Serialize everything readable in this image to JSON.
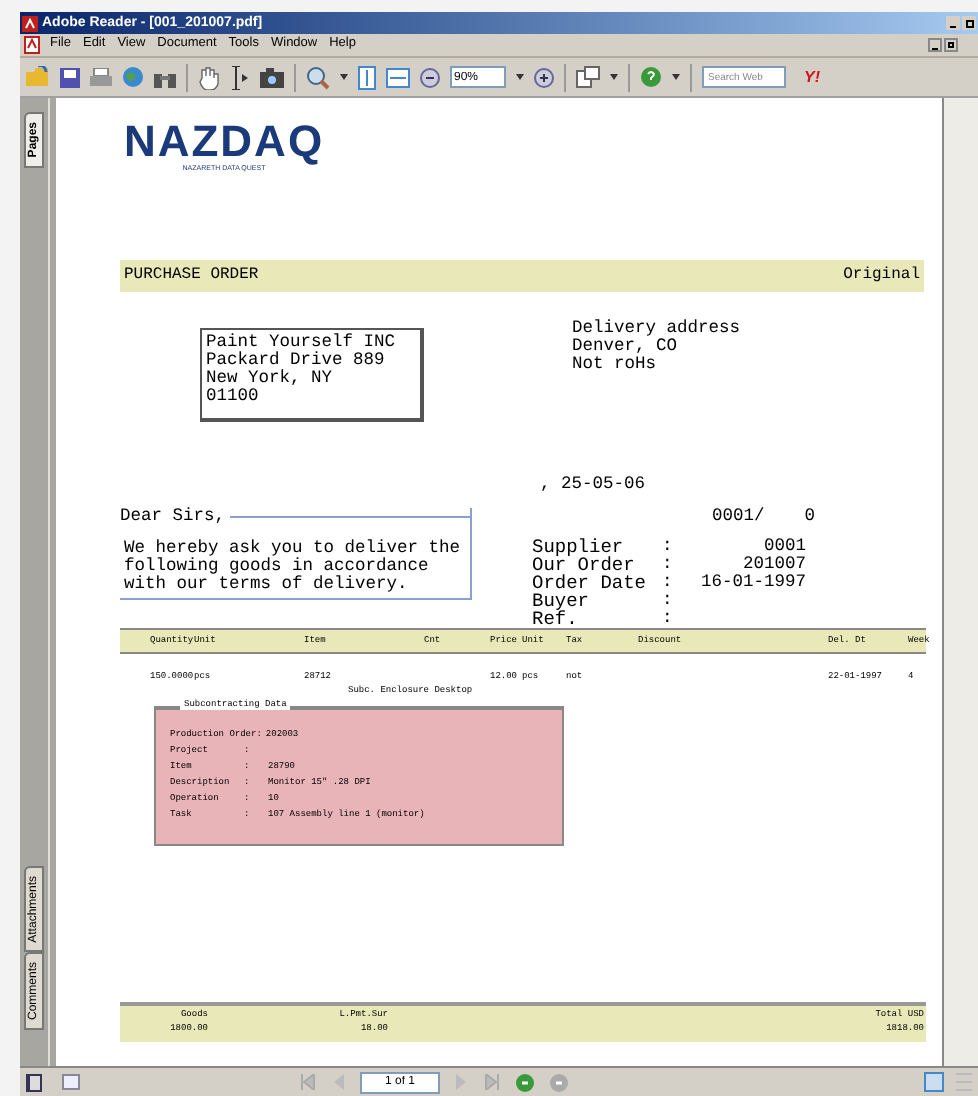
{
  "window": {
    "title": "Adobe Reader - [001_201007.pdf]"
  },
  "menu": [
    "File",
    "Edit",
    "View",
    "Document",
    "Tools",
    "Window",
    "Help"
  ],
  "toolbar": {
    "zoom_value": "90%",
    "search_placeholder": "Search Web",
    "search_logo": "Y!"
  },
  "nav_tabs": [
    {
      "label": "Pages",
      "selected": true
    },
    {
      "label": "Attachments",
      "selected": false
    },
    {
      "label": "Comments",
      "selected": false
    }
  ],
  "document": {
    "logo": {
      "name": "NAZDAQ",
      "tagline": "NAZARETH DATA QUEST"
    },
    "header": {
      "title": "PURCHASE ORDER",
      "copy": "Original"
    },
    "address": [
      "Paint Yourself INC",
      "Packard Drive 889",
      "New York, NY",
      "01100"
    ],
    "delivery": [
      "Delivery address",
      "Denver, CO",
      "Not roHs"
    ],
    "date": ", 25-05-06",
    "greeting": "Dear Sirs,",
    "letter": "We hereby ask you to deliver the following goods in accordance with our terms of delivery.",
    "reference": {
      "number": "0001/",
      "suffix": "0"
    },
    "info": [
      {
        "label": "Supplier",
        "separator": ":",
        "value": "0001"
      },
      {
        "label": "Our Order",
        "separator": ":",
        "value": "201007"
      },
      {
        "label": "Order Date",
        "separator": ":",
        "value": "16-01-1997"
      },
      {
        "label": "Buyer",
        "separator": ":"
      },
      {
        "label": "Ref.",
        "separator": ":"
      }
    ],
    "table": {
      "columns": [
        "Quantity",
        "Unit",
        "Item",
        "Cnt",
        "Price",
        "Unit",
        "Tax",
        "Discount",
        "Del. Dt",
        "Week"
      ],
      "rows": [
        {
          "cells": [
            "150.0000",
            "pcs",
            "28712",
            null,
            "12.00",
            "pcs",
            "not",
            null,
            "22-01-1997",
            "4"
          ],
          "description": "Subc. Enclosure Desktop"
        }
      ]
    },
    "subcontracting": {
      "title": "Subcontracting Data",
      "rows": [
        {
          "label": "Production Order",
          "separator": ":",
          "value": "202003",
          "kind": "inline"
        },
        {
          "label": "Project",
          "separator": ":",
          "kind": "column"
        },
        {
          "label": "Item",
          "separator": ":",
          "value": "28790",
          "kind": "column"
        },
        {
          "label": "Description",
          "separator": ":",
          "value": "Monitor 15\" .28 DPI",
          "kind": "column"
        },
        {
          "label": "Operation",
          "separator": ":",
          "value": "10",
          "kind": "column"
        },
        {
          "label": "Task",
          "separator": ":",
          "value": "107 Assembly line 1 (monitor)",
          "kind": "column"
        }
      ]
    },
    "totals": [
      {
        "label": "Goods",
        "value": "1800.00"
      },
      {
        "label": "L.Pmt.Sur",
        "value": "18.00"
      },
      {
        "label": "Total USD",
        "value": "1818.00"
      }
    ]
  },
  "status_bar": {
    "page_field": "1 of 1"
  }
}
